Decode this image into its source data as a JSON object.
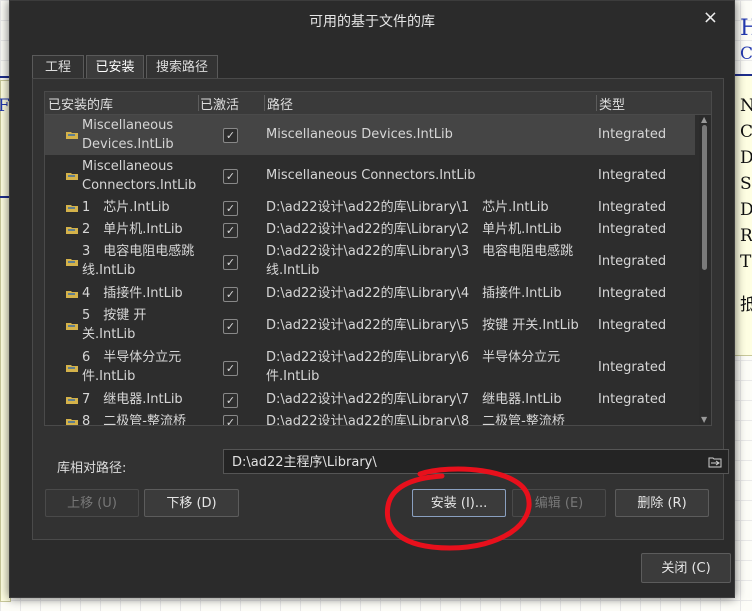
{
  "dialog": {
    "title": "可用的基于文件的库",
    "close_glyph": "×"
  },
  "tabs": [
    {
      "label": "工程",
      "active": false
    },
    {
      "label": "已安装",
      "active": true
    },
    {
      "label": "搜索路径",
      "active": false
    }
  ],
  "table": {
    "headers": {
      "library": "已安装的库",
      "activated": "已激活",
      "path": "路径",
      "type": "类型"
    },
    "rows": [
      {
        "name": "Miscellaneous Devices.IntLib",
        "checked": true,
        "path": "Miscellaneous Devices.IntLib",
        "type": "Integrated",
        "selected": true
      },
      {
        "name": "Miscellaneous Connectors.IntLib",
        "checked": true,
        "path": "Miscellaneous Connectors.IntLib",
        "type": "Integrated",
        "selected": false
      },
      {
        "name": "1　芯片.IntLib",
        "checked": true,
        "path": "D:\\ad22设计\\ad22的库\\Library\\1　芯片.IntLib",
        "type": "Integrated",
        "selected": false
      },
      {
        "name": "2　单片机.IntLib",
        "checked": true,
        "path": "D:\\ad22设计\\ad22的库\\Library\\2　单片机.IntLib",
        "type": "Integrated",
        "selected": false
      },
      {
        "name": "3　电容电阻电感跳线.IntLib",
        "checked": true,
        "path": "D:\\ad22设计\\ad22的库\\Library\\3　电容电阻电感跳线.IntLib",
        "type": "Integrated",
        "selected": false
      },
      {
        "name": "4　插接件.IntLib",
        "checked": true,
        "path": "D:\\ad22设计\\ad22的库\\Library\\4　插接件.IntLib",
        "type": "Integrated",
        "selected": false
      },
      {
        "name": "5　按键 开关.IntLib",
        "checked": true,
        "path": "D:\\ad22设计\\ad22的库\\Library\\5　按键 开关.IntLib",
        "type": "Integrated",
        "selected": false
      },
      {
        "name": "6　半导体分立元件.IntLib",
        "checked": true,
        "path": "D:\\ad22设计\\ad22的库\\Library\\6　半导体分立元件.IntLib",
        "type": "Integrated",
        "selected": false
      },
      {
        "name": "7　继电器.IntLib",
        "checked": true,
        "path": "D:\\ad22设计\\ad22的库\\Library\\7　继电器.IntLib",
        "type": "Integrated",
        "selected": false
      },
      {
        "name": "8　二极管-整流桥",
        "checked": true,
        "path": "D:\\ad22设计\\ad22的库\\Library\\8　二极管-整流桥",
        "type": "",
        "selected": false
      }
    ]
  },
  "relative_path": {
    "label": "库相对路径:",
    "value": "D:\\ad22主程序\\Library\\"
  },
  "buttons": {
    "move_up": "上移 (U)",
    "move_down": "下移 (D)",
    "install": "安装 (I)...",
    "edit": "编辑 (E)",
    "remove": "删除 (R)",
    "close": "关闭 (C)"
  },
  "background": {
    "text_fragments": [
      "H",
      "C",
      "F",
      "N",
      "C",
      "D",
      "S",
      "D",
      "R",
      "T",
      "抵"
    ]
  },
  "colors": {
    "dialog_bg": "#2b2b2b",
    "annotation_red": "#e8101c",
    "selected_row": "#454545"
  }
}
